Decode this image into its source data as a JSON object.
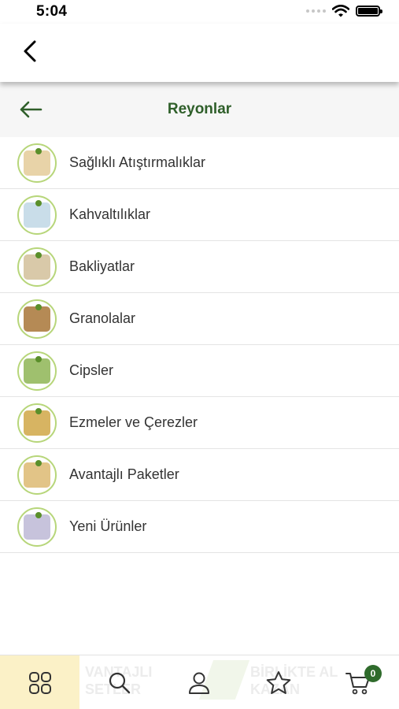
{
  "status_bar": {
    "time": "5:04"
  },
  "header": {
    "title": "Reyonlar"
  },
  "categories": [
    {
      "label": "Sağlıklı Atıştırmalıklar",
      "thumb_color": "#e8d3a8"
    },
    {
      "label": "Kahvaltılıklar",
      "thumb_color": "#c9dde9"
    },
    {
      "label": "Bakliyatlar",
      "thumb_color": "#d9c9a9"
    },
    {
      "label": "Granolalar",
      "thumb_color": "#b58a55"
    },
    {
      "label": "Cipsler",
      "thumb_color": "#9fc06e"
    },
    {
      "label": "Ezmeler ve Çerezler",
      "thumb_color": "#d7b462"
    },
    {
      "label": "Avantajlı Paketler",
      "thumb_color": "#e2c487"
    },
    {
      "label": "Yeni Ürünler",
      "thumb_color": "#c7c3dc"
    }
  ],
  "bottom_banner": {
    "left_line1": "VANTAJLI",
    "left_line2": "SETLER",
    "right_line1": "BİRLİKTE AL",
    "right_line2": "KAZAN"
  },
  "tabs": {
    "items": [
      "categories-icon",
      "search-icon",
      "profile-icon",
      "favorites-icon",
      "cart-icon"
    ],
    "cart_count": "0"
  },
  "colors": {
    "accent_green": "#2f5f2a",
    "active_tab_bg": "#fbf1c7",
    "thumb_ring": "#b7d67a"
  }
}
